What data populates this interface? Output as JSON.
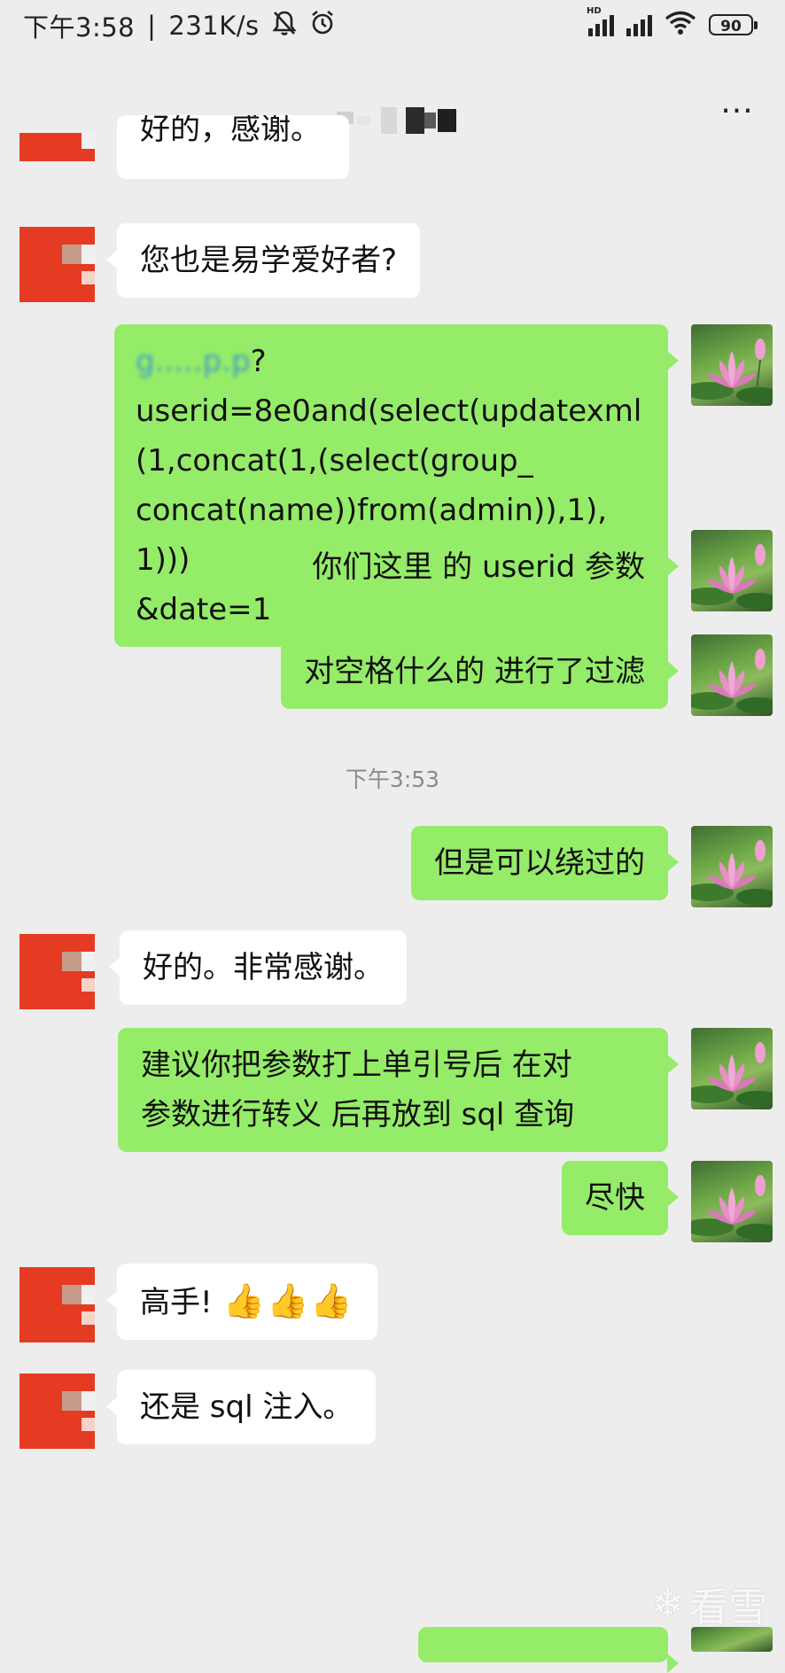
{
  "status_bar": {
    "time": "下午3:58",
    "speed": "231K/s",
    "hd_label": "HD",
    "battery": "90"
  },
  "header": {
    "title_masked": true,
    "more_icon": "more-dots-icon"
  },
  "messages": [
    {
      "id": "m0",
      "side": "left",
      "text": "好的，感谢。",
      "partial": true
    },
    {
      "id": "m1",
      "side": "left",
      "text": "您也是易学爱好者?"
    },
    {
      "id": "m2",
      "side": "right",
      "url_blurred": "g.....p.p",
      "text_lines": [
        "?",
        "userid=8e0and(select(updatexml",
        "(1,concat(1,(select(group_",
        "concat(name))from(admin)),1),1)))",
        "&date=1"
      ]
    },
    {
      "id": "m3",
      "side": "right",
      "text": "你们这里 的 userid 参数"
    },
    {
      "id": "m4",
      "side": "right",
      "text": "对空格什么的 进行了过滤"
    },
    {
      "id": "t1",
      "type": "time",
      "text": "下午3:53"
    },
    {
      "id": "m5",
      "side": "right",
      "text": "但是可以绕过的"
    },
    {
      "id": "m6",
      "side": "left",
      "text": "好的。非常感谢。"
    },
    {
      "id": "m7",
      "side": "right",
      "text_lines": [
        "建议你把参数打上单引号后 在对",
        "参数进行转义 后再放到 sql 查询"
      ]
    },
    {
      "id": "m8",
      "side": "right",
      "text": "尽快"
    },
    {
      "id": "m9",
      "side": "left",
      "text": "高手!",
      "emoji": "👍👍👍"
    },
    {
      "id": "m10",
      "side": "left",
      "text": "还是 sql 注入。"
    }
  ],
  "watermark": "看雪"
}
